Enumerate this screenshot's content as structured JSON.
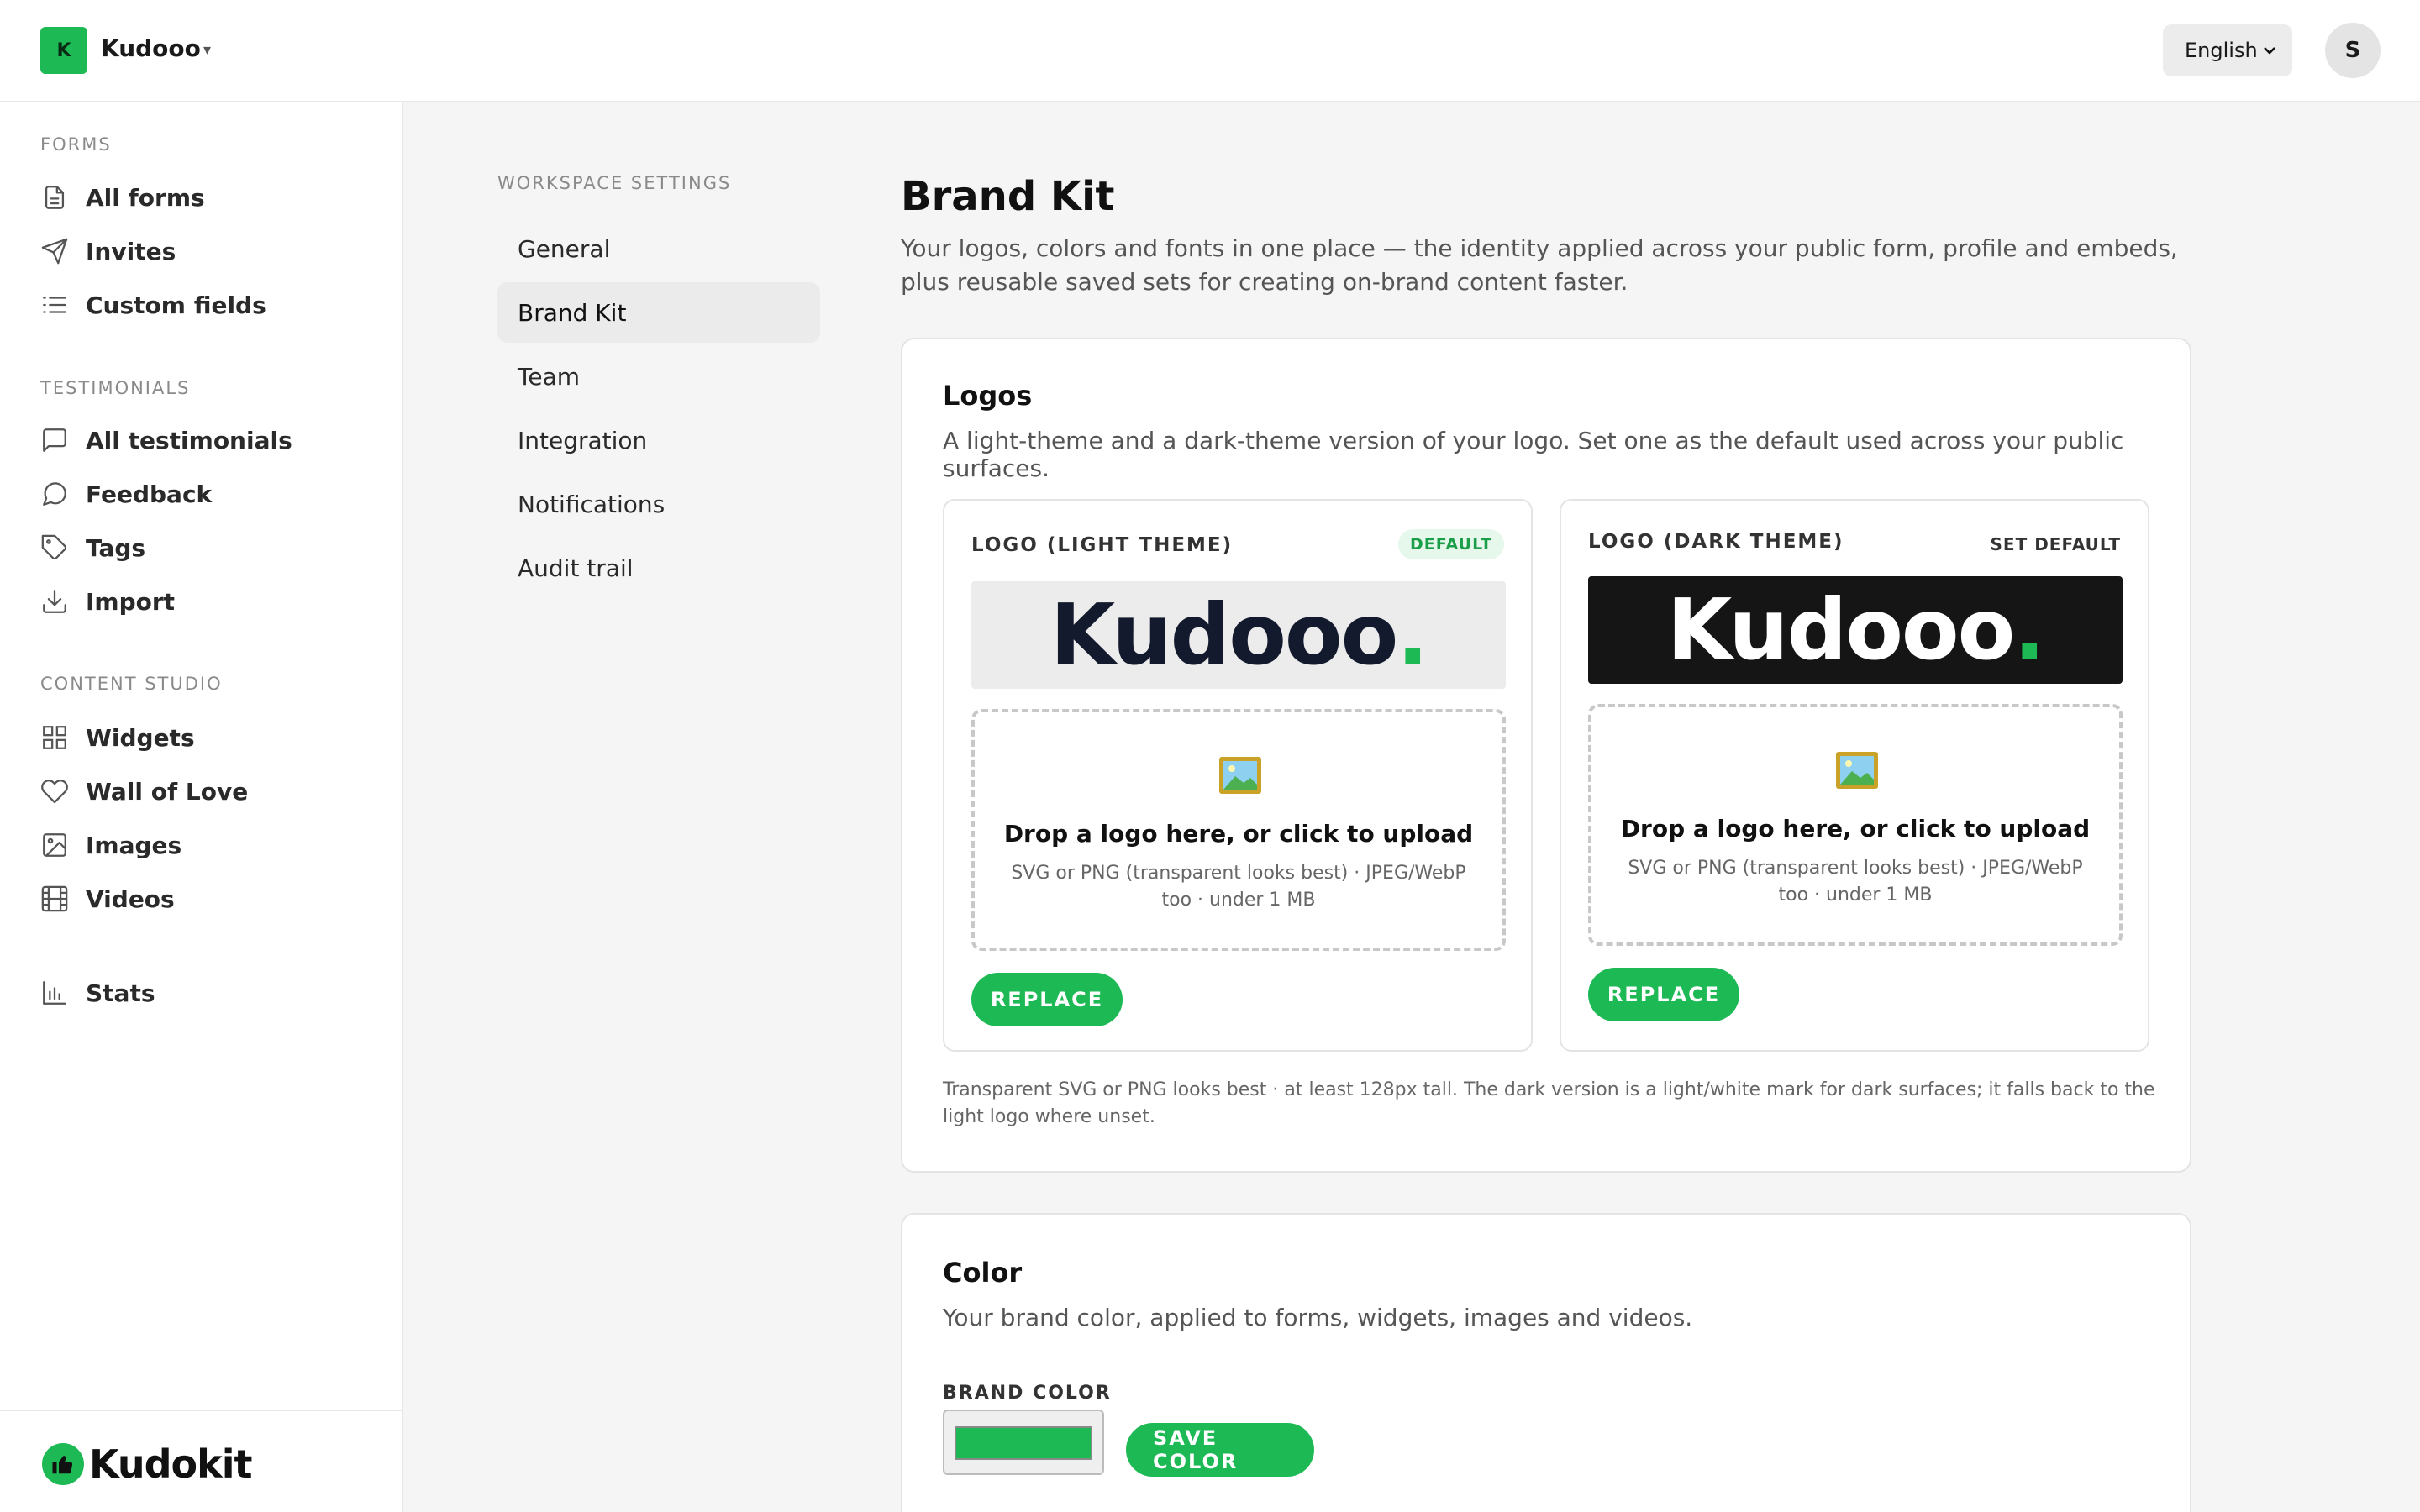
{
  "topbar": {
    "workspace_initial": "K",
    "workspace_name": "Kudooo",
    "workspace_caret": "▾",
    "language": "English",
    "avatar_initial": "S"
  },
  "sidebar": {
    "sections": [
      {
        "label": "FORMS"
      },
      {
        "label": "TESTIMONIALS"
      },
      {
        "label": "CONTENT STUDIO"
      }
    ],
    "items": [
      {
        "label": "All forms",
        "icon": "file-icon"
      },
      {
        "label": "Invites",
        "icon": "send-icon"
      },
      {
        "label": "Custom fields",
        "icon": "list-icon"
      },
      {
        "label": "All testimonials",
        "icon": "message-square-icon"
      },
      {
        "label": "Feedback",
        "icon": "message-circle-icon"
      },
      {
        "label": "Tags",
        "icon": "tag-icon"
      },
      {
        "label": "Import",
        "icon": "download-icon"
      },
      {
        "label": "Widgets",
        "icon": "grid-icon"
      },
      {
        "label": "Wall of Love",
        "icon": "heart-icon"
      },
      {
        "label": "Images",
        "icon": "image-icon"
      },
      {
        "label": "Videos",
        "icon": "film-icon"
      },
      {
        "label": "Stats",
        "icon": "bar-chart-icon"
      }
    ],
    "footer_brand": "Kudokit"
  },
  "settings_nav": {
    "label": "WORKSPACE SETTINGS",
    "items": [
      {
        "label": "General"
      },
      {
        "label": "Brand Kit",
        "active": true
      },
      {
        "label": "Team"
      },
      {
        "label": "Integration"
      },
      {
        "label": "Notifications"
      },
      {
        "label": "Audit trail"
      }
    ]
  },
  "page": {
    "title": "Brand Kit",
    "subtitle": "Your logos, colors and fonts in one place — the identity applied across your public form, profile and embeds, plus reusable saved sets for creating on-brand content faster."
  },
  "logos": {
    "title": "Logos",
    "subtitle": "A light-theme and a dark-theme version of your logo. Set one as the default used across your public surfaces.",
    "light": {
      "label": "LOGO (LIGHT THEME)",
      "badge": "DEFAULT",
      "wordmark": "Kudooo",
      "wordmark_dot": ".",
      "drop_title": "Drop a logo here, or click to upload",
      "drop_hint": "SVG or PNG (transparent looks best) · JPEG/WebP too · under 1 MB",
      "button": "REPLACE"
    },
    "dark": {
      "label": "LOGO (DARK THEME)",
      "set_default": "SET DEFAULT",
      "wordmark": "Kudooo",
      "wordmark_dot": ".",
      "drop_title": "Drop a logo here, or click to upload",
      "drop_hint": "SVG or PNG (transparent looks best) · JPEG/WebP too · under 1 MB",
      "button": "REPLACE"
    },
    "note": "Transparent SVG or PNG looks best · at least 128px tall. The dark version is a light/white mark for dark surfaces; it falls back to the light logo where unset."
  },
  "color": {
    "title": "Color",
    "subtitle": "Your brand color, applied to forms, widgets, images and videos.",
    "field_label": "BRAND COLOR",
    "value": "#1DB954",
    "button": "SAVE COLOR"
  },
  "colors": {
    "accent": "#1DB954",
    "dark_preview": "#151515",
    "light_preview": "#ECECEC"
  }
}
